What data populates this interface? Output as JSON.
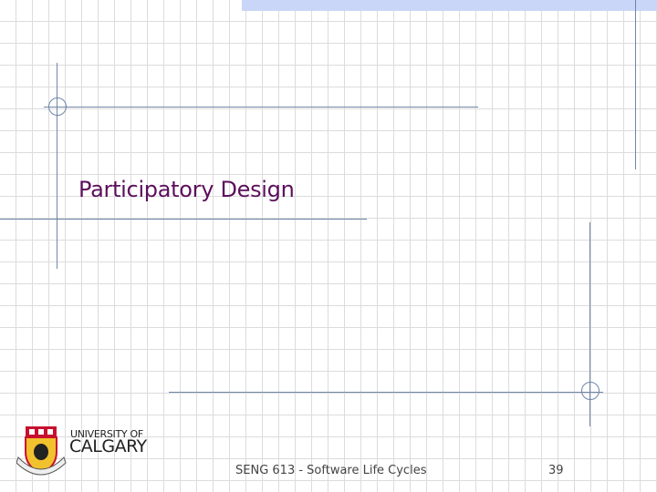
{
  "slide": {
    "title": "Participatory Design",
    "footer": "SENG 613 - Software Life Cycles",
    "page_number": "39"
  },
  "logo": {
    "line1": "UNIVERSITY OF",
    "line2": "CALGARY"
  },
  "colors": {
    "title": "#5c0f5c",
    "lines": "#6f86a8",
    "band": "#c9d6f7"
  }
}
